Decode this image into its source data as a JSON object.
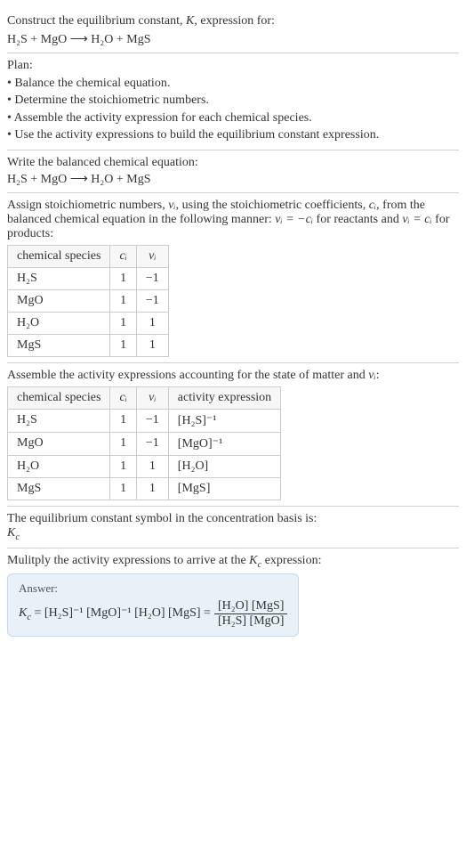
{
  "header": {
    "prompt": "Construct the equilibrium constant, K, expression for:",
    "equation": "H₂S + MgO ⟶ H₂O + MgS"
  },
  "plan": {
    "title": "Plan:",
    "items": [
      "• Balance the chemical equation.",
      "• Determine the stoichiometric numbers.",
      "• Assemble the activity expression for each chemical species.",
      "• Use the activity expressions to build the equilibrium constant expression."
    ]
  },
  "balanced": {
    "title": "Write the balanced chemical equation:",
    "equation": "H₂S + MgO ⟶ H₂O + MgS"
  },
  "stoich": {
    "intro_a": "Assign stoichiometric numbers, ",
    "intro_b": ", using the stoichiometric coefficients, ",
    "intro_c": ", from the balanced chemical equation in the following manner: ",
    "intro_d": " for reactants and ",
    "intro_e": " for products:",
    "nu_i": "νᵢ",
    "c_i": "cᵢ",
    "rel1": "νᵢ = −cᵢ",
    "rel2": "νᵢ = cᵢ",
    "headers": [
      "chemical species",
      "cᵢ",
      "νᵢ"
    ],
    "rows": [
      {
        "species": "H₂S",
        "c": "1",
        "nu": "−1"
      },
      {
        "species": "MgO",
        "c": "1",
        "nu": "−1"
      },
      {
        "species": "H₂O",
        "c": "1",
        "nu": "1"
      },
      {
        "species": "MgS",
        "c": "1",
        "nu": "1"
      }
    ]
  },
  "activity": {
    "title_a": "Assemble the activity expressions accounting for the state of matter and ",
    "title_b": ":",
    "nu_i": "νᵢ",
    "headers": [
      "chemical species",
      "cᵢ",
      "νᵢ",
      "activity expression"
    ],
    "rows": [
      {
        "species": "H₂S",
        "c": "1",
        "nu": "−1",
        "expr": "[H₂S]⁻¹"
      },
      {
        "species": "MgO",
        "c": "1",
        "nu": "−1",
        "expr": "[MgO]⁻¹"
      },
      {
        "species": "H₂O",
        "c": "1",
        "nu": "1",
        "expr": "[H₂O]"
      },
      {
        "species": "MgS",
        "c": "1",
        "nu": "1",
        "expr": "[MgS]"
      }
    ]
  },
  "symbol": {
    "title": "The equilibrium constant symbol in the concentration basis is:",
    "value": "K𞁞"
  },
  "multiply": {
    "title_a": "Mulitply the activity expressions to arrive at the ",
    "title_b": " expression:",
    "kc": "K𞁞"
  },
  "answer": {
    "label": "Answer:",
    "lhs": "K𞁞 = [H₂S]⁻¹ [MgO]⁻¹ [H₂O] [MgS] = ",
    "num": "[H₂O] [MgS]",
    "den": "[H₂S] [MgO]"
  }
}
